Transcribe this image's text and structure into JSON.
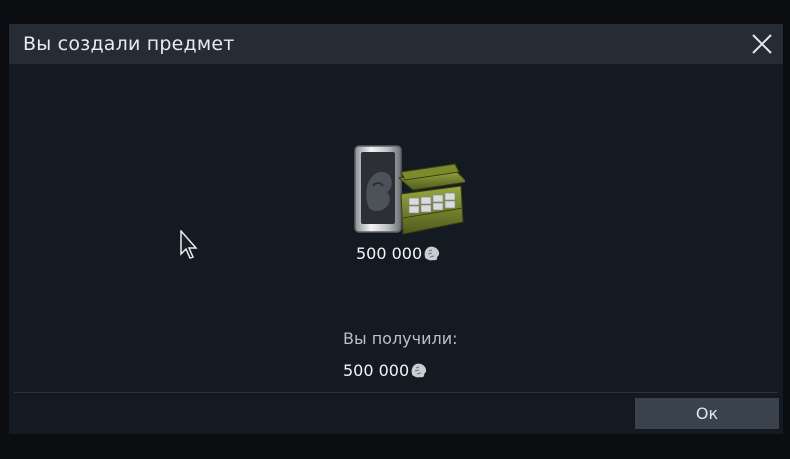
{
  "dialog": {
    "title": "Вы создали предмет",
    "close_icon": "close-icon",
    "item": {
      "icon": "silver-lion-crate-icon",
      "amount": "500 000",
      "currency_icon": "silver-lion-icon"
    },
    "received_label": "Вы получили:",
    "received_amount": "500 000",
    "ok_label": "Ок"
  },
  "colors": {
    "background": "#0b0d10",
    "dialog_body": "#141a22",
    "titlebar": "#262c35",
    "button": "#3a434d"
  }
}
